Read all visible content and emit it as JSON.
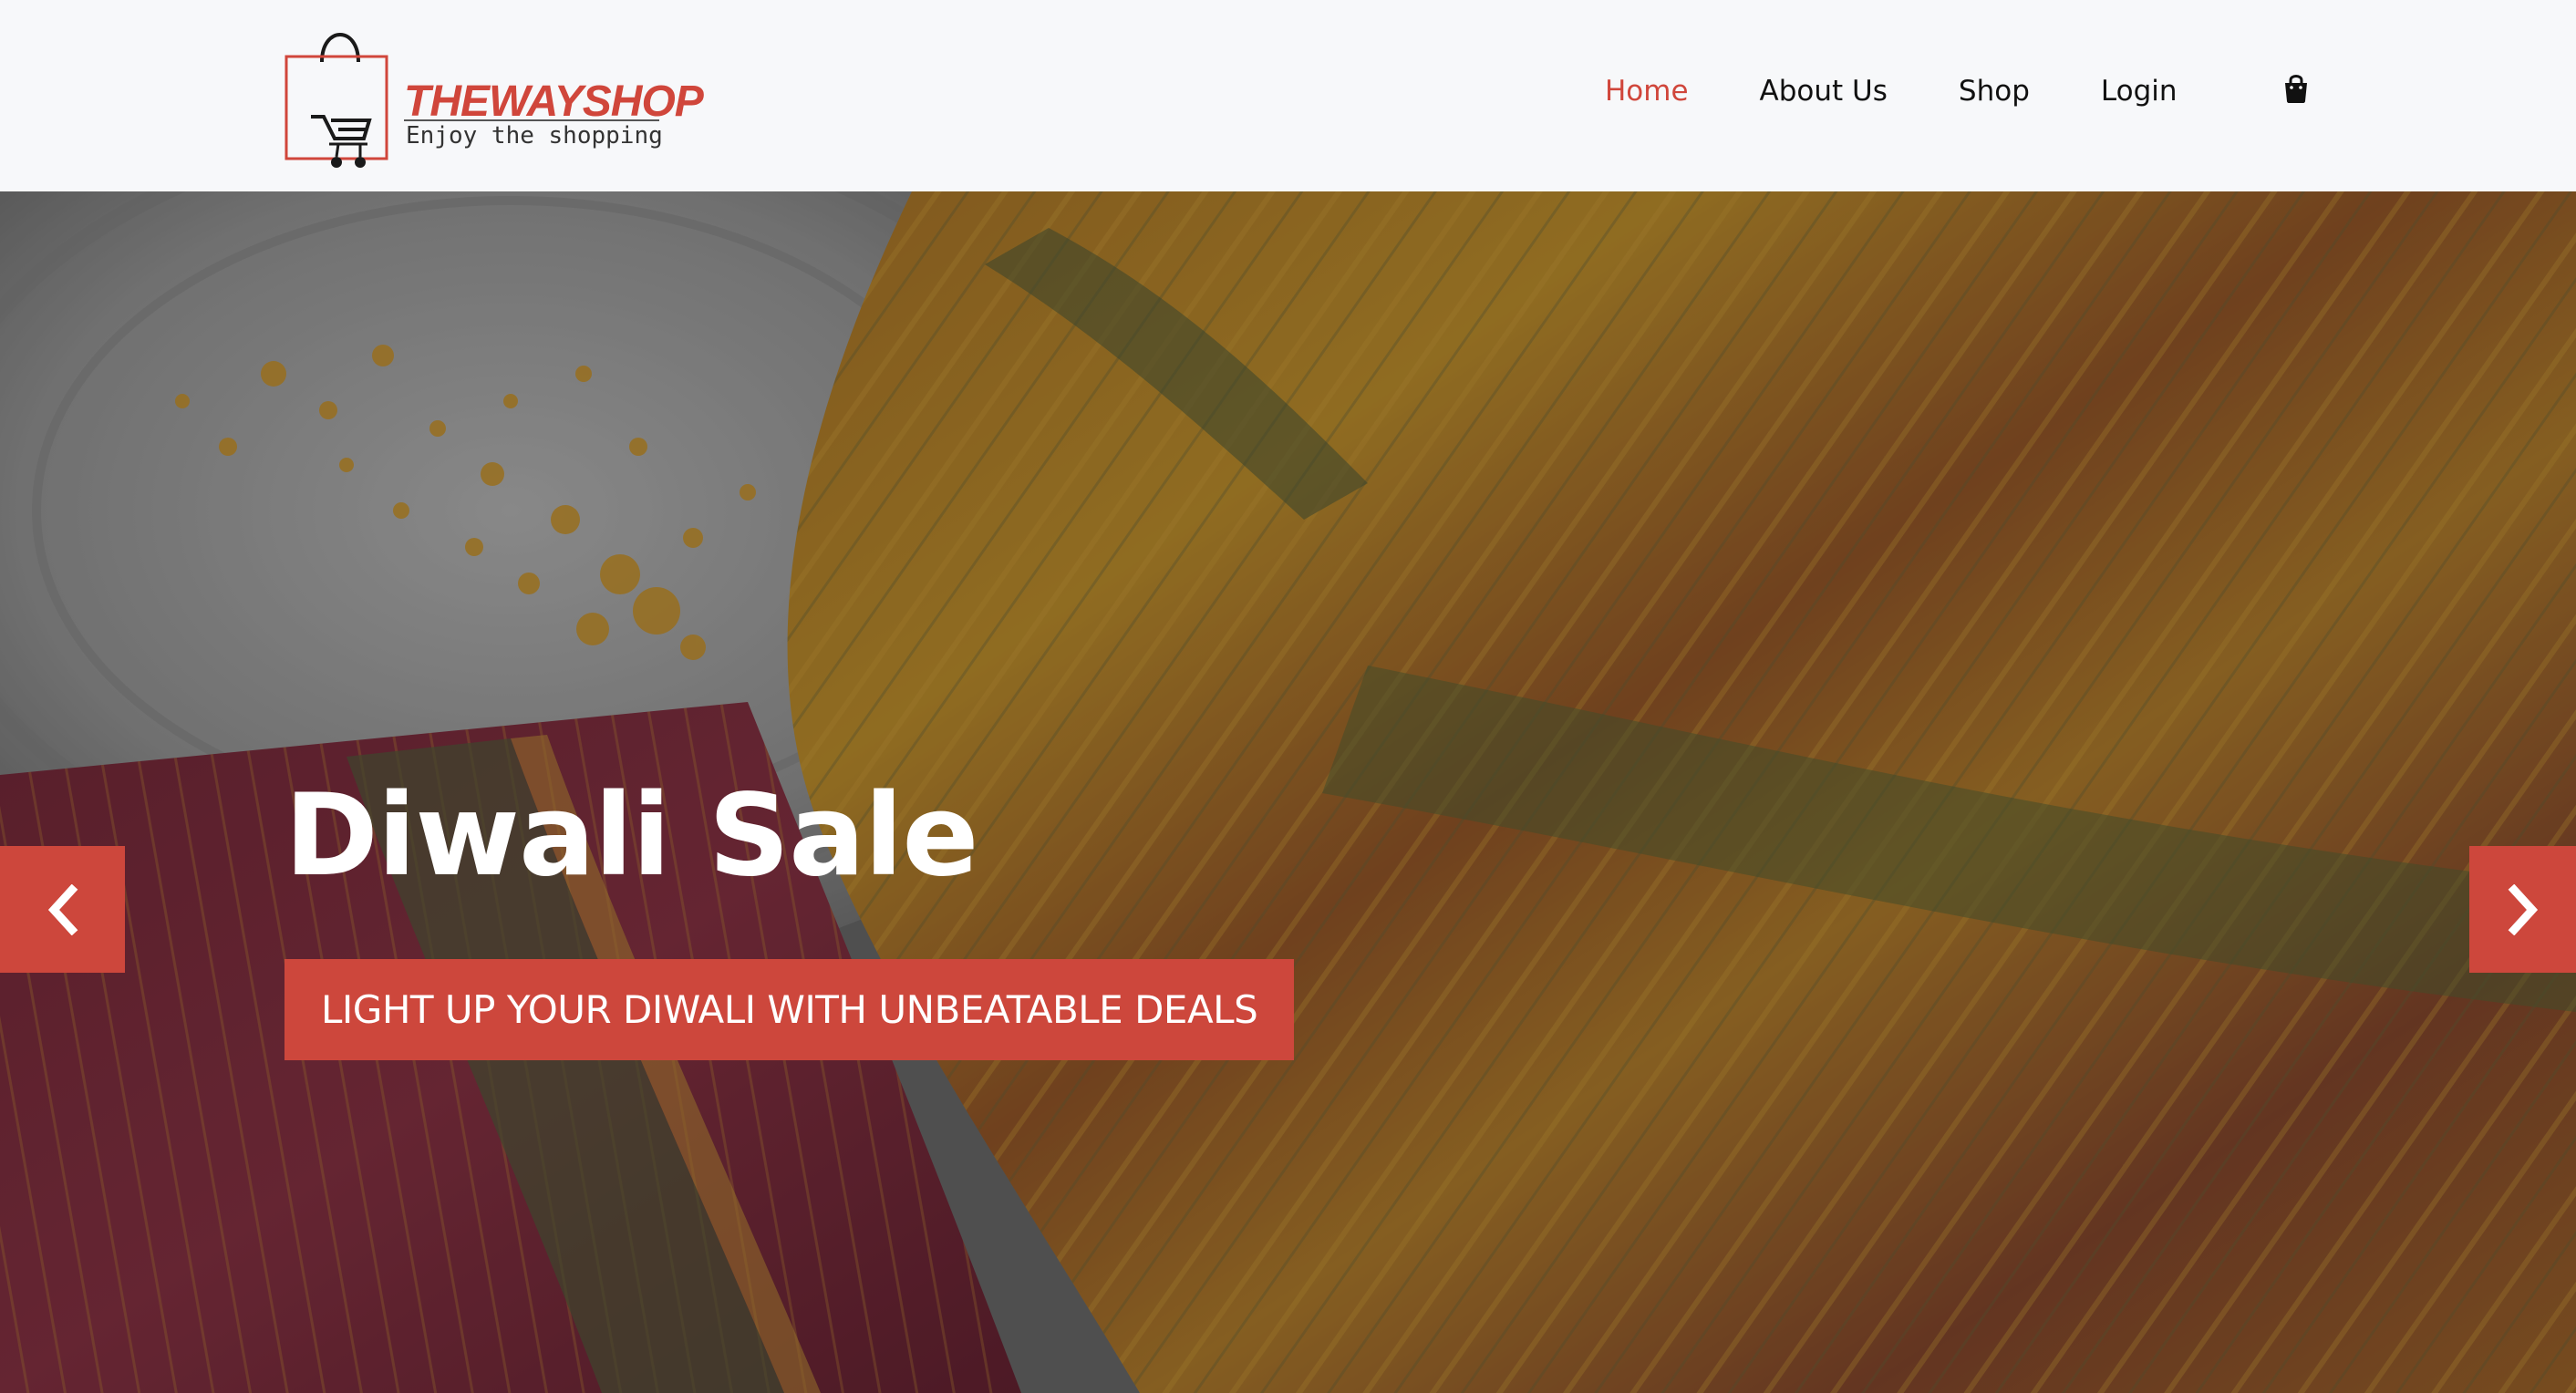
{
  "brand": {
    "name": "THEWAYSHOP",
    "tagline": "Enjoy the shopping"
  },
  "nav": {
    "items": [
      {
        "label": "Home",
        "active": true
      },
      {
        "label": "About Us",
        "active": false
      },
      {
        "label": "Shop",
        "active": false
      },
      {
        "label": "Login",
        "active": false
      }
    ],
    "cart_icon": "shopping-bag-icon"
  },
  "hero": {
    "title": "Diwali Sale",
    "cta_label": "LIGHT UP YOUR DIWALI WITH UNBEATABLE DEALS",
    "prev_icon": "chevron-left-icon",
    "next_icon": "chevron-right-icon"
  },
  "colors": {
    "accent": "#cd473c",
    "nav_background": "#f7f8fa",
    "nav_text": "#111111",
    "hero_text": "#ffffff"
  }
}
